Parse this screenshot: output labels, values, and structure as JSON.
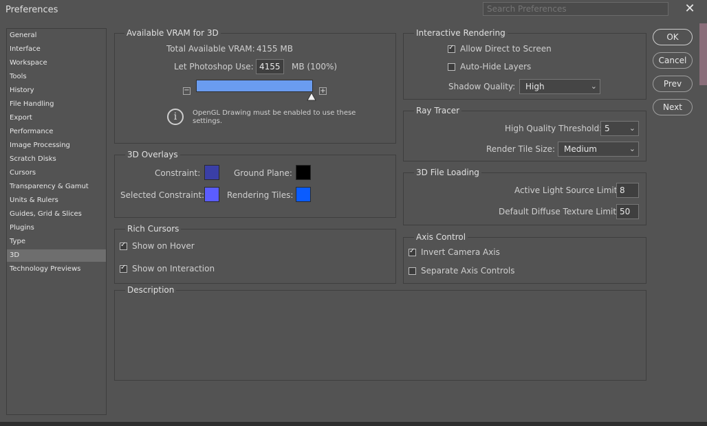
{
  "window": {
    "title": "Preferences",
    "close_glyph": "✕"
  },
  "search": {
    "placeholder": "Search Preferences"
  },
  "sidebar": {
    "items": [
      {
        "label": "General"
      },
      {
        "label": "Interface"
      },
      {
        "label": "Workspace"
      },
      {
        "label": "Tools"
      },
      {
        "label": "History"
      },
      {
        "label": "File Handling"
      },
      {
        "label": "Export"
      },
      {
        "label": "Performance"
      },
      {
        "label": "Image Processing"
      },
      {
        "label": "Scratch Disks"
      },
      {
        "label": "Cursors"
      },
      {
        "label": "Transparency & Gamut"
      },
      {
        "label": "Units & Rulers"
      },
      {
        "label": "Guides, Grid & Slices"
      },
      {
        "label": "Plugins"
      },
      {
        "label": "Type"
      },
      {
        "label": "3D",
        "selected": true
      },
      {
        "label": "Technology Previews"
      }
    ]
  },
  "vram": {
    "title": "Available VRAM for 3D",
    "total_label": "Total Available VRAM:",
    "total_value": "4155 MB",
    "use_label": "Let Photoshop Use:",
    "use_value": "4155",
    "use_unit": "MB (100%)",
    "minus": "−",
    "plus": "+",
    "slider_fraction": 1.0,
    "info_icon": "i",
    "info_text_1": "OpenGL Drawing must be enabled to use these",
    "info_text_2": "settings."
  },
  "overlays": {
    "title": "3D Overlays",
    "constraint_label": "Constraint:",
    "ground_label": "Ground Plane:",
    "selected_label": "Selected Constraint:",
    "tiles_label": "Rendering Tiles:",
    "colors": {
      "constraint": "#3a3fa6",
      "ground": "#000000",
      "selected": "#5b5dff",
      "tiles": "#0a5cff"
    }
  },
  "rich_cursors": {
    "title": "Rich Cursors",
    "hover_label": "Show on Hover",
    "hover_checked": true,
    "interaction_label": "Show on Interaction",
    "interaction_checked": true
  },
  "interactive": {
    "title": "Interactive Rendering",
    "direct_label": "Allow Direct to Screen",
    "direct_checked": true,
    "autohide_label": "Auto-Hide Layers",
    "autohide_checked": false,
    "shadow_label": "Shadow Quality:",
    "shadow_value": "High"
  },
  "raytracer": {
    "title": "Ray Tracer",
    "threshold_label": "High Quality Threshold:",
    "threshold_value": "5",
    "tile_label": "Render Tile Size:",
    "tile_value": "Medium"
  },
  "fileloading": {
    "title": "3D File Loading",
    "light_label": "Active Light Source Limit:",
    "light_value": "8",
    "texture_label": "Default Diffuse Texture Limit:",
    "texture_value": "50"
  },
  "axis": {
    "title": "Axis Control",
    "invert_label": "Invert Camera Axis",
    "invert_checked": true,
    "separate_label": "Separate Axis Controls",
    "separate_checked": false
  },
  "description": {
    "title": "Description"
  },
  "buttons": {
    "ok": "OK",
    "cancel": "Cancel",
    "prev": "Prev",
    "next": "Next"
  },
  "chevron": "⌄"
}
